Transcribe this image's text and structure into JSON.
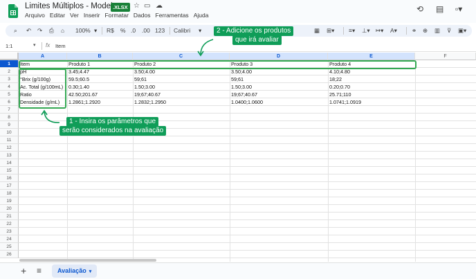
{
  "app": {
    "doc_title": "Limites Múltiplos - Modelo",
    "file_badge": ".XLSX",
    "menu": [
      "Arquivo",
      "Editar",
      "Ver",
      "Inserir",
      "Formatar",
      "Dados",
      "Ferramentas",
      "Ajuda"
    ]
  },
  "toolbar": {
    "zoom": "100%",
    "currency": "R$",
    "percent": "%",
    "dec_decrease": ".0",
    "dec_increase": ".00",
    "number_format": "123",
    "font": "Calibri"
  },
  "formula_bar": {
    "name_box": "1:1",
    "fx_label": "fx",
    "value": "Item"
  },
  "sheet": {
    "columns": [
      "A",
      "B",
      "C",
      "D",
      "E",
      "F"
    ],
    "rows": [
      "1",
      "2",
      "3",
      "4",
      "5",
      "6",
      "7",
      "8",
      "9",
      "10",
      "11",
      "12",
      "13",
      "14",
      "15",
      "16",
      "17",
      "18",
      "19",
      "20",
      "21",
      "22",
      "23",
      "24",
      "25",
      "26"
    ],
    "header_row": [
      "Item",
      "Produto 1",
      "Produto 2",
      "Produto 3",
      "Produto 4"
    ],
    "data": [
      [
        "pH",
        "3.45;4.47",
        "3.50;4.00",
        "3.50;4.00",
        "4.10;4.80"
      ],
      [
        "°Brix (g/100g)",
        "59.5;60.5",
        "59;61",
        "59;61",
        "18;22"
      ],
      [
        "Ac. Total (g/100mL)",
        "0.30;1.40",
        "1.50;3.00",
        "1.50;3.00",
        "0.20;0.70"
      ],
      [
        "Ratio",
        "42.50;201.67",
        "19;67;40.67",
        "19;67;40.67",
        "25.71;110"
      ],
      [
        "Densidade (g/mL)",
        "1.2861;1.2920",
        "1.2832;1.2950",
        "1.0400;1.0600",
        "1.0741;1.0919"
      ]
    ]
  },
  "callouts": {
    "products": [
      "2 - Adicione os produtos",
      "que irá avaliar"
    ],
    "parameters": [
      "1 - Insira os parâmetros que",
      "serão considerados na avaliação"
    ],
    "color": "#0f9d58"
  },
  "tabs": {
    "active_sheet": "Avaliação"
  },
  "icons": {
    "search": "search-icon",
    "undo": "undo-icon",
    "redo": "redo-icon",
    "print": "print-icon",
    "paint_format": "paint-format-icon",
    "history": "history-icon",
    "comments": "comments-icon",
    "meet": "meet-icon",
    "star": "star-icon",
    "move": "folder-move-icon",
    "cloud": "cloud-status-icon"
  }
}
